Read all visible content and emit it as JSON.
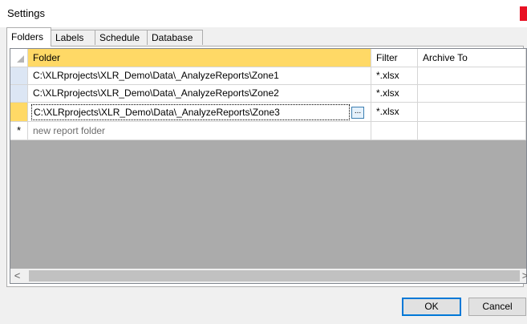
{
  "window": {
    "title": "Settings"
  },
  "tabs": [
    {
      "label": "Folders",
      "active": true
    },
    {
      "label": "Labels"
    },
    {
      "label": "Schedule"
    },
    {
      "label": "Database"
    }
  ],
  "grid": {
    "columns": [
      "Folder",
      "Filter",
      "Archive To"
    ],
    "rows": [
      {
        "folder": "C:\\XLRprojects\\XLR_Demo\\Data\\_AnalyzeReports\\Zone1",
        "filter": "*.xlsx",
        "archive_to": ""
      },
      {
        "folder": "C:\\XLRprojects\\XLR_Demo\\Data\\_AnalyzeReports\\Zone2",
        "filter": "*.xlsx",
        "archive_to": ""
      },
      {
        "folder": "C:\\XLRprojects\\XLR_Demo\\Data\\_AnalyzeReports\\Zone3",
        "filter": "*.xlsx",
        "archive_to": ""
      }
    ],
    "new_row_marker": "*",
    "new_row_placeholder": "new report folder",
    "ellipsis_label": "...",
    "scroll_left": "<",
    "scroll_right": ">"
  },
  "buttons": {
    "ok": "OK",
    "cancel": "Cancel"
  },
  "colors": {
    "current_row": "#ffd966",
    "selected_header": "#ffd966",
    "ok_border": "#0078d7",
    "close": "#e81123"
  }
}
